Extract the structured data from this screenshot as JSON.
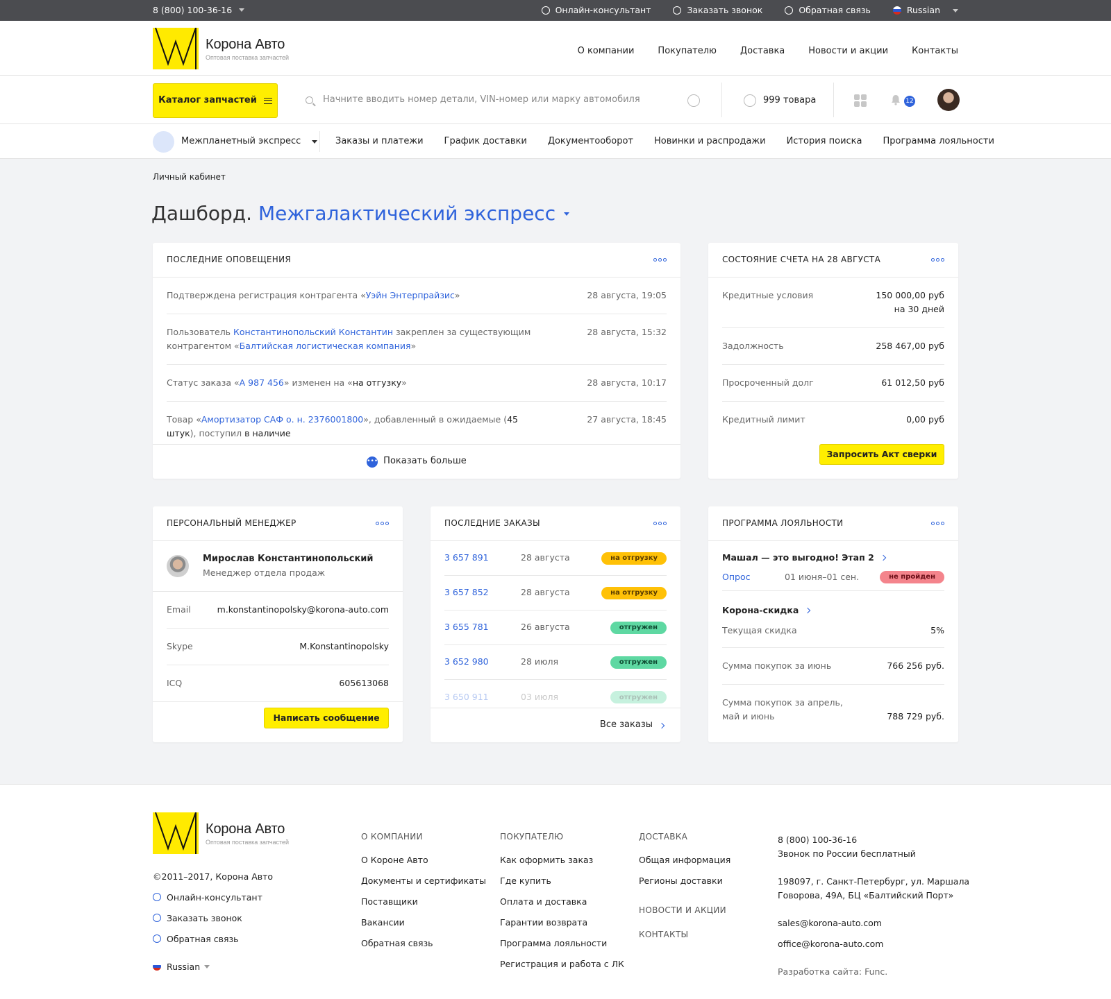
{
  "topbar": {
    "phone": "8 (800) 100-36-16",
    "online": "Онлайн-консультант",
    "callback": "Заказать звонок",
    "feedback": "Обратная связь",
    "lang": "Russian"
  },
  "brand": {
    "name": "Корона Авто",
    "tagline": "Оптовая поставка запчастей",
    "brand_color": "#ffee00",
    "accent": "#2f63db"
  },
  "nav": [
    "О компании",
    "Покупателю",
    "Доставка",
    "Новости и акции",
    "Контакты"
  ],
  "search": {
    "catalog_label": "Каталог запчастей",
    "placeholder": "Начните вводить номер детали, VIN-номер или марку автомобиля",
    "cart": "999 товара",
    "notifications": "12"
  },
  "subnav": {
    "company": "Межпланетный экспресс",
    "links": [
      "Заказы и платежи",
      "График доставки",
      "Документооборот",
      "Новинки и распродажи",
      "История поиска",
      "Программа лояльности"
    ]
  },
  "page": {
    "breadcrumb": "Личный кабинет",
    "title_prefix": "Дашборд.",
    "title_company": "Межгалактический экспресс"
  },
  "notifications": {
    "title": "Последние оповещения",
    "items": [
      {
        "date": "28 августа, 19:05",
        "p1": "Подтверждена регистрация контрагента «",
        "l1": "Уэйн Энтерпрайзис",
        "p2": "»"
      },
      {
        "date": "28 августа, 15:32",
        "p1": "Пользователь ",
        "l1": "Константинопольский Константин",
        "p2": " закреплен за существующим контрагентом «",
        "l2": "Балтийская логистическая компания",
        "p3": "»"
      },
      {
        "date": "28 августа, 10:17",
        "p1": "Статус заказа «",
        "l1": "А 987 456",
        "p2": "» изменен на «",
        "s1": "на отгузку",
        "p3": "»"
      },
      {
        "date": "27 августа, 18:45",
        "p1": "Товар «",
        "l1": "Амортизатор САФ о. н. 2376001800",
        "p2": "», добавленный в ожидаемые (",
        "s1": "45 штук",
        "p3": "), поступил ",
        "s2": "в наличие"
      }
    ],
    "more": "Показать больше"
  },
  "account": {
    "title": "Состояние счета на 28 августа",
    "rows": [
      {
        "label": "Кредитные условия",
        "value": "150 000,00 руб",
        "value2": "на 30 дней"
      },
      {
        "label": "Задолжность",
        "value": "258 467,00 руб"
      },
      {
        "label": "Просроченный долг",
        "value": "61 012,50 руб"
      },
      {
        "label": "Кредитный лимит",
        "value": "0,00 руб"
      }
    ],
    "button": "Запросить Акт сверки"
  },
  "manager": {
    "title": "Персональный менеджер",
    "name": "Мирослав Константинопольский",
    "role": "Менеджер отдела продаж",
    "rows": [
      {
        "label": "Email",
        "value": "m.konstantinopolsky@korona-auto.com"
      },
      {
        "label": "Skype",
        "value": "M.Konstantinopolsky"
      },
      {
        "label": "ICQ",
        "value": "605613068"
      }
    ],
    "button": "Написать сообщение"
  },
  "orders": {
    "title": "Последние заказы",
    "items": [
      {
        "number": "3 657 891",
        "date": "28 августа",
        "status": "на отгрузку",
        "kind": "y"
      },
      {
        "number": "3 657 852",
        "date": "28 августа",
        "status": "на отгрузку",
        "kind": "y"
      },
      {
        "number": "3 655 781",
        "date": "26 августа",
        "status": "отгружен",
        "kind": "g"
      },
      {
        "number": "3 652 980",
        "date": "28 июля",
        "status": "отгружен",
        "kind": "g"
      },
      {
        "number": "3 650 911",
        "date": "03 июля",
        "status": "отгружен",
        "kind": "g"
      }
    ],
    "all": "Все заказы"
  },
  "loyalty": {
    "title": "Программа лояльности",
    "promo": "Машал — это выгодно! Этап 2",
    "survey": "Опрос",
    "survey_dates": "01 июня–01 сен.",
    "survey_status": "не пройден",
    "discount_title": "Корона-скидка",
    "rows": [
      {
        "label": "Текущая скидка",
        "value": "5%"
      },
      {
        "label": "Сумма покупок за июнь",
        "value": "766 256 руб."
      },
      {
        "label": "Сумма покупок за апрель,",
        "label2": "май и июнь",
        "value": "788 729 руб."
      }
    ]
  },
  "footer": {
    "copyright": "©2011–2017, Корона Авто",
    "contacts": [
      "Онлайн-консультант",
      "Заказать звонок",
      "Обратная связь"
    ],
    "lang": "Russian",
    "col1": {
      "head": "О компании",
      "items": [
        "О Короне Авто",
        "Документы и сертификаты",
        "Поставщики",
        "Вакансии",
        "Обратная связь"
      ]
    },
    "col2": {
      "head": "Покупателю",
      "items": [
        "Как оформить заказ",
        "Где купить",
        "Оплата и доставка",
        "Гарантии возврата",
        "Программа лояльности",
        "Регистрация и работа с ЛК"
      ]
    },
    "col3": {
      "head": "Доставка",
      "items": [
        "Общая информация",
        "Регионы доставки"
      ],
      "head2": "Новости и акции",
      "head3": "Контакты"
    },
    "phone": "8 (800) 100-36-16",
    "phone_note": "Звонок по России бесплатный",
    "address1": "198097, г. Санкт-Петербург, ул. Маршала",
    "address2": "Говорова, 49А, БЦ «Балтийский Порт»",
    "email1": "sales@korona-auto.com",
    "email2": "office@korona-auto.com",
    "dev_label": "Разработка сайта:",
    "dev": "Func."
  }
}
